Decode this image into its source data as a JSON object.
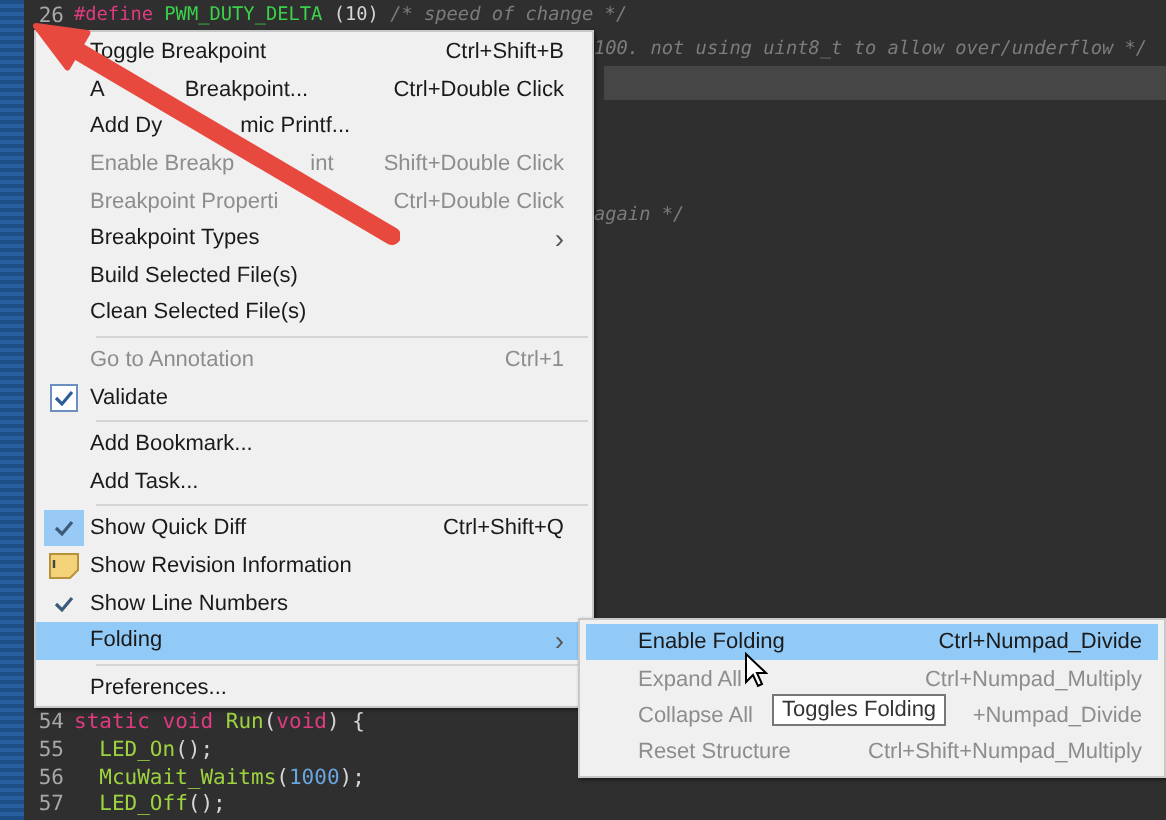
{
  "editor": {
    "top_lines": [
      {
        "number": "26",
        "kind": "code",
        "current": false,
        "segments": [
          {
            "text": "#define",
            "kind": "keyword"
          },
          {
            "text": " PWM_DUTY_DELTA",
            "kind": "macro"
          },
          {
            "text": " (10) ",
            "kind": "plain"
          },
          {
            "text": "/* speed of change */",
            "kind": "comment"
          }
        ]
      },
      {
        "kind": "continued",
        "current": false,
        "segments": [
          {
            "text": "100. not using uint8_t to allow over/underflow */",
            "kind": "comment"
          }
        ]
      },
      {
        "current": true
      },
      {
        "kind": "continued",
        "current": false,
        "segments": [
          {
            "text": "again */",
            "kind": "comment"
          }
        ]
      }
    ],
    "bottom_lines": [
      {
        "number": "54",
        "segments": [
          {
            "text": "static void",
            "kind": "keyword"
          },
          {
            "text": " Run",
            "kind": "func"
          },
          {
            "text": "(",
            "kind": "plain"
          },
          {
            "text": "void",
            "kind": "keyword"
          },
          {
            "text": ") {",
            "kind": "plain"
          }
        ]
      },
      {
        "number": "55",
        "segments": [
          {
            "text": "  LED_On",
            "kind": "func"
          },
          {
            "text": "();",
            "kind": "plain"
          }
        ]
      },
      {
        "number": "56",
        "segments": [
          {
            "text": "  McuWait_Waitms",
            "kind": "func"
          },
          {
            "text": "(",
            "kind": "plain"
          },
          {
            "text": "1000",
            "kind": "number"
          },
          {
            "text": ");",
            "kind": "plain"
          }
        ]
      },
      {
        "number": "57",
        "segments": [
          {
            "text": "  LED_Off",
            "kind": "func"
          },
          {
            "text": "();",
            "kind": "plain"
          }
        ]
      }
    ]
  },
  "context_menu": {
    "items": [
      {
        "kind": "command",
        "label_parts": [
          "Toggle Breakpoint"
        ],
        "shortcut": "Ctrl+Shift+B",
        "disabled": false,
        "selected": false
      },
      {
        "kind": "command",
        "label_parts": [
          "A",
          "Breakpoint..."
        ],
        "shortcut": "Ctrl+Double Click",
        "disabled": false,
        "selected": false
      },
      {
        "kind": "command",
        "label_parts": [
          "Add Dy",
          "mic Printf..."
        ],
        "disabled": false,
        "selected": false
      },
      {
        "kind": "command",
        "label_parts": [
          "Enable Breakp",
          "int"
        ],
        "shortcut": "Shift+Double Click",
        "disabled": true,
        "selected": false
      },
      {
        "kind": "command",
        "label_parts": [
          "Breakpoint Properti"
        ],
        "shortcut": "Ctrl+Double Click",
        "disabled": true,
        "selected": false
      },
      {
        "kind": "submenu",
        "label_parts": [
          "Breakpoint Types"
        ],
        "chevron": "›",
        "disabled": false,
        "selected": false
      },
      {
        "kind": "command",
        "label_parts": [
          "Build Selected File(s)"
        ],
        "disabled": false,
        "selected": false
      },
      {
        "kind": "command",
        "label_parts": [
          "Clean Selected File(s)"
        ],
        "disabled": false,
        "selected": false
      },
      {
        "kind": "separator"
      },
      {
        "kind": "command",
        "label_parts": [
          "Go to Annotation"
        ],
        "shortcut": "Ctrl+1",
        "disabled": true,
        "selected": false
      },
      {
        "kind": "check-box",
        "label_parts": [
          "Validate"
        ],
        "disabled": false,
        "selected": false,
        "checked": true
      },
      {
        "kind": "separator"
      },
      {
        "kind": "command",
        "label_parts": [
          "Add Bookmark..."
        ],
        "disabled": false,
        "selected": false
      },
      {
        "kind": "command",
        "label_parts": [
          "Add Task..."
        ],
        "disabled": false,
        "selected": false
      },
      {
        "kind": "separator"
      },
      {
        "kind": "check-tile",
        "label_parts": [
          "Show Quick Diff"
        ],
        "shortcut": "Ctrl+Shift+Q",
        "disabled": false,
        "selected": false,
        "checked": true
      },
      {
        "kind": "icon",
        "label_parts": [
          "Show Revision Information"
        ],
        "disabled": false,
        "selected": false
      },
      {
        "kind": "check-plain",
        "label_parts": [
          "Show Line Numbers"
        ],
        "disabled": false,
        "selected": false,
        "checked": true
      },
      {
        "kind": "submenu",
        "label_parts": [
          "Folding"
        ],
        "chevron": "›",
        "disabled": false,
        "selected": true
      },
      {
        "kind": "separator"
      },
      {
        "kind": "command",
        "label_parts": [
          "Preferences..."
        ],
        "disabled": false,
        "selected": false
      }
    ]
  },
  "submenu": {
    "items": [
      {
        "label": "Enable Folding",
        "shortcut": "Ctrl+Numpad_Divide",
        "disabled": false,
        "selected": true
      },
      {
        "label": "Expand All",
        "shortcut": "Ctrl+Numpad_Multiply",
        "disabled": true,
        "selected": false
      },
      {
        "label": "Collapse All",
        "shortcut": "+Numpad_Divide",
        "disabled": true,
        "selected": false
      },
      {
        "label": "Reset Structure",
        "shortcut": "Ctrl+Shift+Numpad_Multiply",
        "disabled": true,
        "selected": false
      }
    ]
  },
  "tooltip": {
    "text": "Toggles Folding"
  }
}
